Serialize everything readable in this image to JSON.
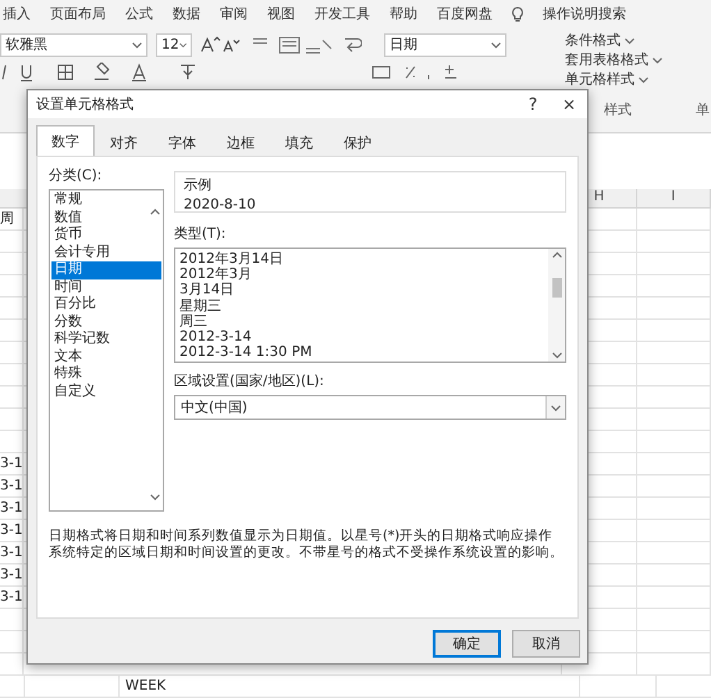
{
  "ribbon": {
    "tabs": [
      "插入",
      "页面布局",
      "公式",
      "数据",
      "审阅",
      "视图",
      "开发工具",
      "帮助",
      "百度网盘"
    ],
    "search": "操作说明搜索",
    "font_name": "软雅黑",
    "font_size": "12",
    "number_format": "日期",
    "style_buttons": [
      "条件格式",
      "套用表格格式",
      "单元格样式"
    ],
    "group_label": "样式",
    "group_label_2": "单"
  },
  "sheet": {
    "columns": [
      "H",
      "I"
    ],
    "left_cells": [
      "周",
      "",
      "",
      "",
      "",
      "",
      "",
      "",
      "",
      "",
      "",
      "3-1",
      "3-1",
      "3-1",
      "3-1",
      "3-1",
      "3-1",
      "3-1",
      "",
      "",
      ""
    ],
    "bottom_cell": "WEEK"
  },
  "dialog": {
    "title": "设置单元格格式",
    "help": "?",
    "close": "×",
    "tabs": [
      {
        "label": "数字",
        "selected": true
      },
      {
        "label": "对齐",
        "selected": false
      },
      {
        "label": "字体",
        "selected": false
      },
      {
        "label": "边框",
        "selected": false
      },
      {
        "label": "填充",
        "selected": false
      },
      {
        "label": "保护",
        "selected": false
      }
    ],
    "category_label": "分类(C):",
    "categories": [
      {
        "label": "常规",
        "selected": false
      },
      {
        "label": "数值",
        "selected": false
      },
      {
        "label": "货币",
        "selected": false
      },
      {
        "label": "会计专用",
        "selected": false
      },
      {
        "label": "日期",
        "selected": true
      },
      {
        "label": "时间",
        "selected": false
      },
      {
        "label": "百分比",
        "selected": false
      },
      {
        "label": "分数",
        "selected": false
      },
      {
        "label": "科学记数",
        "selected": false
      },
      {
        "label": "文本",
        "selected": false
      },
      {
        "label": "特殊",
        "selected": false
      },
      {
        "label": "自定义",
        "selected": false
      }
    ],
    "sample_label": "示例",
    "sample_value": "2020-8-10",
    "type_label": "类型(T):",
    "types": [
      "2012年3月14日",
      "2012年3月",
      "3月14日",
      "星期三",
      "周三",
      "2012-3-14",
      "2012-3-14 1:30 PM"
    ],
    "locale_label": "区域设置(国家/地区)(L):",
    "locale_value": "中文(中国)",
    "description": "日期格式将日期和时间系列数值显示为日期值。以星号(*)开头的日期格式响应操作系统特定的区域日期和时间设置的更改。不带星号的格式不受操作系统设置的影响。",
    "buttons": [
      {
        "label": "确定",
        "default": true
      },
      {
        "label": "取消",
        "default": false
      }
    ]
  }
}
